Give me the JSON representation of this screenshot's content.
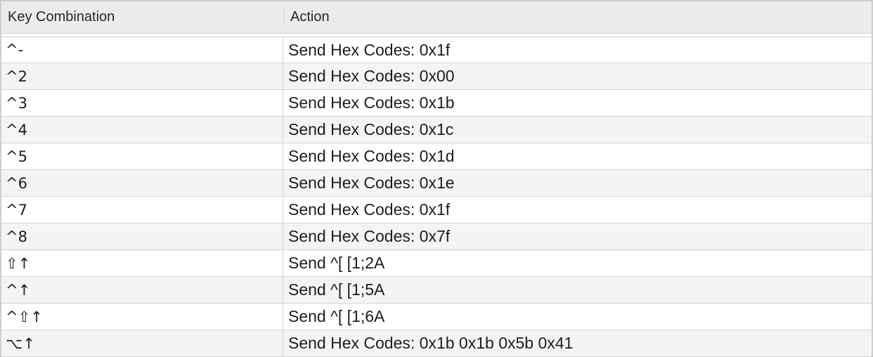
{
  "table": {
    "columns": {
      "key": "Key Combination",
      "action": "Action"
    },
    "rows": [
      {
        "key": "^-",
        "action": "Send Hex Codes: 0x1f"
      },
      {
        "key": "^2",
        "action": "Send Hex Codes: 0x00"
      },
      {
        "key": "^3",
        "action": "Send Hex Codes: 0x1b"
      },
      {
        "key": "^4",
        "action": "Send Hex Codes: 0x1c"
      },
      {
        "key": "^5",
        "action": "Send Hex Codes: 0x1d"
      },
      {
        "key": "^6",
        "action": "Send Hex Codes: 0x1e"
      },
      {
        "key": "^7",
        "action": "Send Hex Codes: 0x1f"
      },
      {
        "key": "^8",
        "action": "Send Hex Codes: 0x7f"
      },
      {
        "key": "⇧↑",
        "action": "Send ^[ [1;2A"
      },
      {
        "key": "^↑",
        "action": "Send ^[ [1;5A"
      },
      {
        "key": "^⇧↑",
        "action": "Send ^[ [1;6A"
      },
      {
        "key": "⌥↑",
        "action": "Send Hex Codes: 0x1b 0x1b 0x5b 0x41"
      }
    ]
  }
}
